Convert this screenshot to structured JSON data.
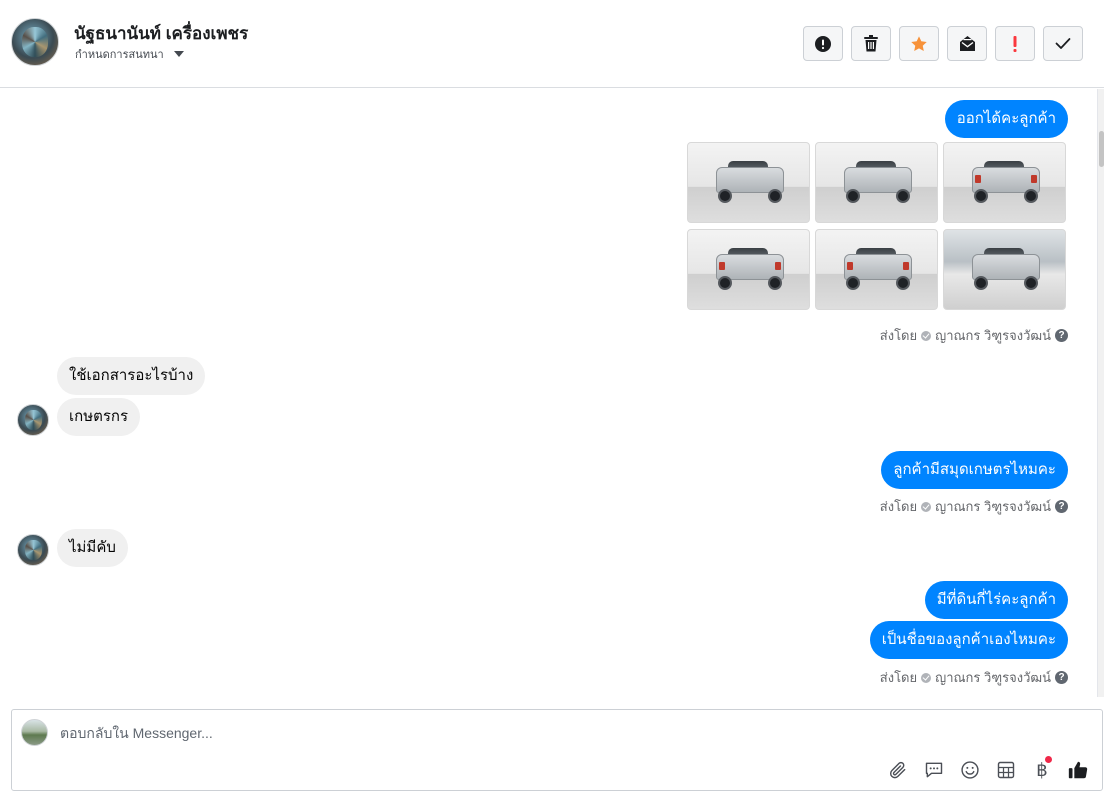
{
  "header": {
    "contact_name": "นัฐธนานันท์ เครื่องเพชร",
    "assign_label": "กำหนดการสนทนา",
    "actions": [
      {
        "name": "mark-spam-button",
        "icon": "alert-circle-icon"
      },
      {
        "name": "delete-button",
        "icon": "trash-icon"
      },
      {
        "name": "star-button",
        "icon": "star-icon"
      },
      {
        "name": "mark-unread-button",
        "icon": "envelope-open-icon"
      },
      {
        "name": "priority-button",
        "icon": "exclamation-icon"
      },
      {
        "name": "mark-done-button",
        "icon": "checkmark-icon"
      }
    ]
  },
  "colors": {
    "outgoing_bubble": "#0084ff",
    "incoming_bubble": "#f0f0f0",
    "star": "#f7923a",
    "priority": "#fa383e"
  },
  "messages": {
    "m1": "ออกได้คะลูกค้า",
    "images_count_label": "",
    "sent_by_1_prefix": "ส่งโดย",
    "sent_by_1_name": "ญาณกร วิฑูรจงวัฒน์",
    "m2": "ใช้เอกสารอะไรบ้าง",
    "m3": "เกษตรกร",
    "m4": "ลูกค้ามีสมุดเกษตรไหมคะ",
    "sent_by_2_prefix": "ส่งโดย",
    "sent_by_2_name": "ญาณกร วิฑูรจงวัฒน์",
    "m5": "ไม่มีคับ",
    "m6": "มีที่ดินกี่ไร่คะลูกค้า",
    "m7": "เป็นชื่อของลูกค้าเองไหมคะ",
    "sent_by_3_prefix": "ส่งโดย",
    "sent_by_3_name": "ญาณกร วิฑูรจงวัฒน์",
    "help_glyph": "?"
  },
  "composer": {
    "placeholder": "ตอบกลับใน Messenger...",
    "tools": [
      "paperclip-icon",
      "saved-reply-icon",
      "emoji-icon",
      "table-icon",
      "baht-icon",
      "thumbs-up-icon"
    ],
    "baht_glyph": "฿"
  }
}
